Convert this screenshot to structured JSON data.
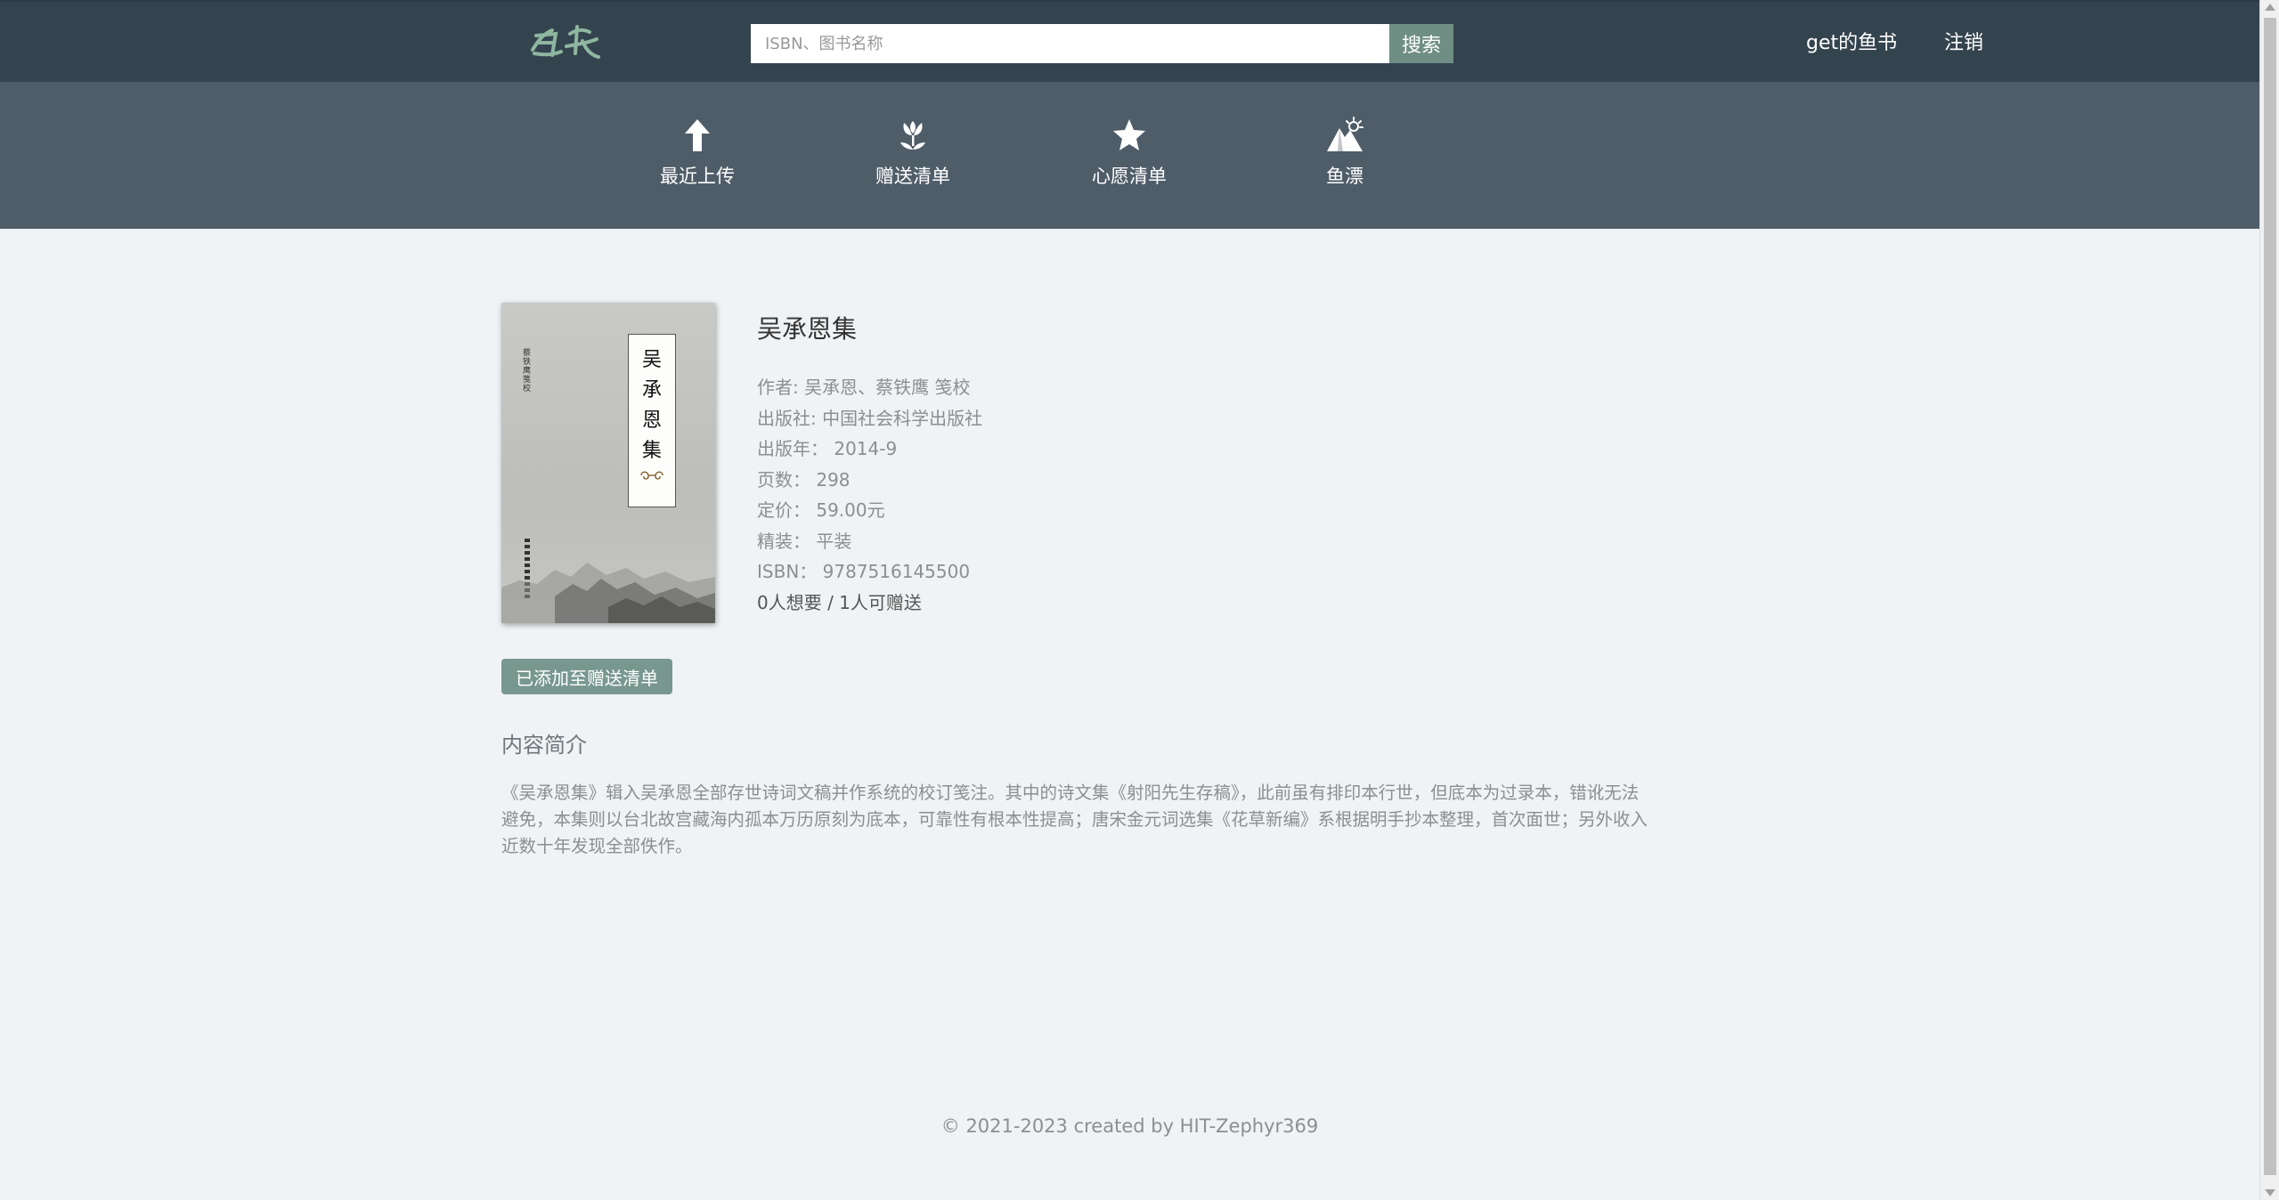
{
  "header": {
    "logo_text": "鱼书",
    "search_placeholder": "ISBN、图书名称",
    "search_button": "搜索",
    "user_name": "get的鱼书",
    "logout": "注销"
  },
  "nav": {
    "items": [
      {
        "label": "最近上传",
        "icon": "upload-arrow-icon"
      },
      {
        "label": "赠送清单",
        "icon": "tulip-icon"
      },
      {
        "label": "心愿清单",
        "icon": "star-icon"
      },
      {
        "label": "鱼漂",
        "icon": "mountain-sun-icon"
      }
    ]
  },
  "book": {
    "cover": {
      "title_chars": [
        "吴",
        "承",
        "恩",
        "集"
      ],
      "side_text": "蔡铁鹰 笺校"
    },
    "title": "吴承恩集",
    "info": [
      {
        "key": "作者: ",
        "value": "吴承恩、蔡铁鹰 笺校"
      },
      {
        "key": "出版社: ",
        "value": "中国社会科学出版社"
      },
      {
        "key": "出版年： ",
        "value": "2014-9"
      },
      {
        "key": "页数： ",
        "value": "298"
      },
      {
        "key": "定价： ",
        "value": "59.00元"
      },
      {
        "key": "精装： ",
        "value": "平装"
      },
      {
        "key": "ISBN： ",
        "value": "9787516145500"
      }
    ],
    "want_give": "0人想要 / 1人可赠送",
    "action_button": "已添加至赠送清单"
  },
  "intro": {
    "heading": "内容简介",
    "text": "《吴承恩集》辑入吴承恩全部存世诗词文稿并作系统的校订笺注。其中的诗文集《射阳先生存稿》，此前虽有排印本行世，但底本为过录本，错讹无法避免，本集则以台北故宫藏海内孤本万历原刻为底本，可靠性有根本性提高；唐宋金元词选集《花草新编》系根据明手抄本整理，首次面世；另外收入近数十年发现全部佚作。"
  },
  "footer": {
    "text": "© 2021-2023 created by HIT-Zephyr369"
  },
  "colors": {
    "header_bg": "#34444f",
    "nav_bg": "#4f5d69",
    "page_bg": "#f0f3f5",
    "accent": "#78988f"
  }
}
